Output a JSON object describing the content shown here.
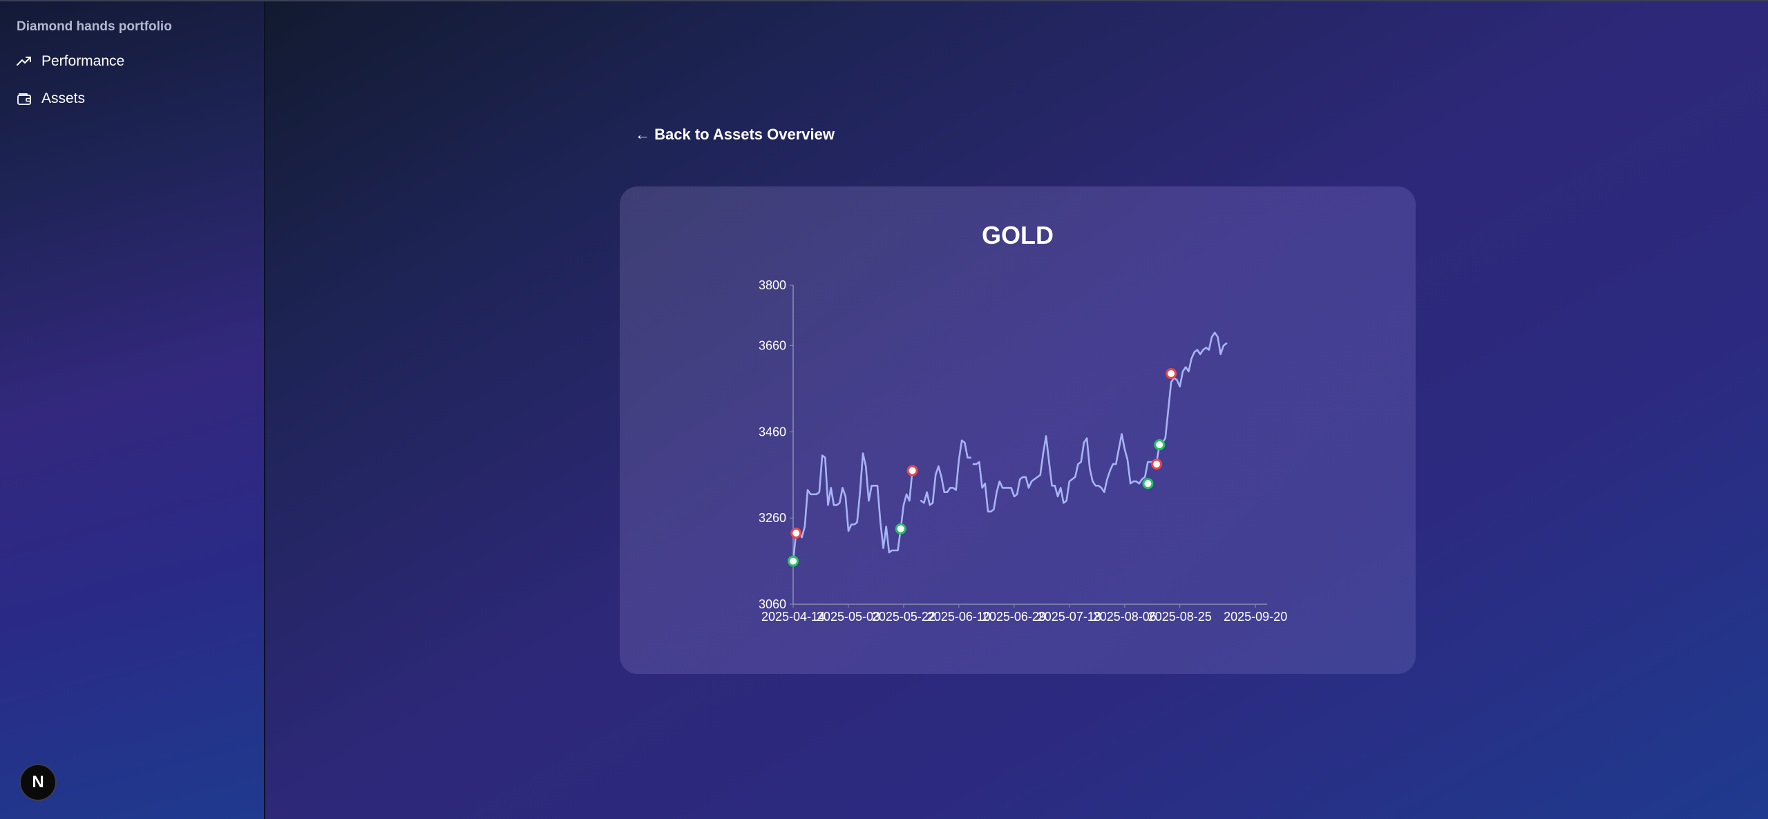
{
  "sidebar": {
    "brand": "Diamond hands portfolio",
    "items": [
      {
        "label": "Performance",
        "icon": "trending-up-icon"
      },
      {
        "label": "Assets",
        "icon": "wallet-icon"
      }
    ],
    "avatar": "N"
  },
  "main": {
    "back_link": "← Back to Assets Overview",
    "title": "GOLD"
  },
  "colors": {
    "line": "#a7b4f5",
    "buy_marker": "#22c55e",
    "sell_marker": "#ef4444",
    "axis": "#8a8fb0"
  },
  "chart_data": {
    "type": "line",
    "title": "GOLD",
    "xlabel": "",
    "ylabel": "",
    "x_range": [
      "2025-04-14",
      "2025-09-24"
    ],
    "ylim": [
      3060,
      3800
    ],
    "y_ticks": [
      3060,
      3260,
      3460,
      3660,
      3800
    ],
    "x_ticks": [
      "2025-04-14",
      "2025-05-03",
      "2025-05-22",
      "2025-06-10",
      "2025-06-29",
      "2025-07-18",
      "2025-08-06",
      "2025-08-25",
      "2025-09-20"
    ],
    "grid": false,
    "legend": "none",
    "series": [
      {
        "segments": [
          [
            [
              "2025-04-14",
              3160
            ],
            [
              "2025-04-15",
              3225
            ],
            [
              "2025-04-16",
              3230
            ],
            [
              "2025-04-17",
              3215
            ],
            [
              "2025-04-18",
              3240
            ],
            [
              "2025-04-19",
              3325
            ],
            [
              "2025-04-20",
              3315
            ],
            [
              "2025-04-21",
              3315
            ],
            [
              "2025-04-22",
              3315
            ],
            [
              "2025-04-23",
              3320
            ],
            [
              "2025-04-24",
              3405
            ],
            [
              "2025-04-25",
              3400
            ],
            [
              "2025-04-26",
              3290
            ],
            [
              "2025-04-27",
              3330
            ],
            [
              "2025-04-28",
              3290
            ],
            [
              "2025-04-29",
              3290
            ],
            [
              "2025-04-30",
              3295
            ],
            [
              "2025-05-01",
              3330
            ],
            [
              "2025-05-02",
              3310
            ],
            [
              "2025-05-03",
              3230
            ],
            [
              "2025-05-04",
              3245
            ],
            [
              "2025-05-05",
              3245
            ],
            [
              "2025-05-06",
              3250
            ],
            [
              "2025-05-07",
              3320
            ],
            [
              "2025-05-08",
              3410
            ],
            [
              "2025-05-09",
              3380
            ],
            [
              "2025-05-10",
              3300
            ],
            [
              "2025-05-11",
              3335
            ],
            [
              "2025-05-12",
              3335
            ],
            [
              "2025-05-13",
              3335
            ],
            [
              "2025-05-14",
              3250
            ],
            [
              "2025-05-15",
              3190
            ],
            [
              "2025-05-16",
              3240
            ],
            [
              "2025-05-17",
              3180
            ],
            [
              "2025-05-18",
              3185
            ],
            [
              "2025-05-19",
              3185
            ],
            [
              "2025-05-20",
              3185
            ],
            [
              "2025-05-21",
              3235
            ],
            [
              "2025-05-22",
              3290
            ],
            [
              "2025-05-23",
              3315
            ],
            [
              "2025-05-24",
              3300
            ],
            [
              "2025-05-25",
              3370
            ]
          ],
          [
            [
              "2025-05-28",
              3300
            ],
            [
              "2025-05-29",
              3295
            ],
            [
              "2025-05-30",
              3320
            ],
            [
              "2025-05-31",
              3290
            ],
            [
              "2025-06-01",
              3295
            ],
            [
              "2025-06-02",
              3360
            ],
            [
              "2025-06-03",
              3380
            ],
            [
              "2025-06-04",
              3355
            ],
            [
              "2025-06-05",
              3320
            ],
            [
              "2025-06-06",
              3320
            ],
            [
              "2025-06-07",
              3330
            ],
            [
              "2025-06-08",
              3330
            ],
            [
              "2025-06-09",
              3325
            ],
            [
              "2025-06-10",
              3395
            ],
            [
              "2025-06-11",
              3440
            ],
            [
              "2025-06-12",
              3435
            ],
            [
              "2025-06-13",
              3400
            ],
            [
              "2025-06-14",
              3400
            ]
          ],
          [
            [
              "2025-06-15",
              3385
            ],
            [
              "2025-06-16",
              3385
            ],
            [
              "2025-06-17",
              3390
            ],
            [
              "2025-06-18",
              3330
            ],
            [
              "2025-06-19",
              3340
            ],
            [
              "2025-06-20",
              3275
            ],
            [
              "2025-06-21",
              3275
            ],
            [
              "2025-06-22",
              3280
            ],
            [
              "2025-06-23",
              3320
            ],
            [
              "2025-06-24",
              3345
            ],
            [
              "2025-06-25",
              3330
            ],
            [
              "2025-06-26",
              3330
            ],
            [
              "2025-06-27",
              3330
            ],
            [
              "2025-06-28",
              3330
            ],
            [
              "2025-06-29",
              3310
            ],
            [
              "2025-06-30",
              3315
            ],
            [
              "2025-07-01",
              3350
            ],
            [
              "2025-07-02",
              3355
            ],
            [
              "2025-07-03",
              3355
            ],
            [
              "2025-07-04",
              3330
            ],
            [
              "2025-07-05",
              3345
            ],
            [
              "2025-07-06",
              3350
            ],
            [
              "2025-07-07",
              3355
            ],
            [
              "2025-07-08",
              3360
            ],
            [
              "2025-07-09",
              3410
            ],
            [
              "2025-07-10",
              3450
            ],
            [
              "2025-07-11",
              3390
            ],
            [
              "2025-07-12",
              3335
            ],
            [
              "2025-07-13",
              3335
            ],
            [
              "2025-07-14",
              3310
            ],
            [
              "2025-07-15",
              3330
            ],
            [
              "2025-07-16",
              3295
            ],
            [
              "2025-07-17",
              3300
            ],
            [
              "2025-07-18",
              3345
            ],
            [
              "2025-07-19",
              3350
            ],
            [
              "2025-07-20",
              3355
            ],
            [
              "2025-07-21",
              3385
            ],
            [
              "2025-07-22",
              3390
            ],
            [
              "2025-07-23",
              3435
            ],
            [
              "2025-07-24",
              3445
            ],
            [
              "2025-07-25",
              3375
            ],
            [
              "2025-07-26",
              3345
            ],
            [
              "2025-07-27",
              3335
            ],
            [
              "2025-07-28",
              3335
            ],
            [
              "2025-07-29",
              3330
            ],
            [
              "2025-07-30",
              3320
            ],
            [
              "2025-07-31",
              3350
            ],
            [
              "2025-08-01",
              3370
            ],
            [
              "2025-08-02",
              3385
            ],
            [
              "2025-08-03",
              3385
            ],
            [
              "2025-08-04",
              3420
            ],
            [
              "2025-08-05",
              3455
            ],
            [
              "2025-08-06",
              3420
            ],
            [
              "2025-08-07",
              3395
            ],
            [
              "2025-08-08",
              3340
            ],
            [
              "2025-08-09",
              3345
            ],
            [
              "2025-08-10",
              3345
            ],
            [
              "2025-08-11",
              3340
            ],
            [
              "2025-08-12",
              3350
            ],
            [
              "2025-08-13",
              3355
            ],
            [
              "2025-08-14",
              3390
            ],
            [
              "2025-08-15",
              3390
            ],
            [
              "2025-08-16",
              3390
            ],
            [
              "2025-08-17",
              3390
            ],
            [
              "2025-08-18",
              3430
            ],
            [
              "2025-08-19",
              3435
            ],
            [
              "2025-08-20",
              3445
            ],
            [
              "2025-08-21",
              3510
            ],
            [
              "2025-08-22",
              3575
            ],
            [
              "2025-08-23",
              3585
            ],
            [
              "2025-08-24",
              3580
            ],
            [
              "2025-08-25",
              3565
            ],
            [
              "2025-08-26",
              3600
            ],
            [
              "2025-08-27",
              3610
            ],
            [
              "2025-08-28",
              3600
            ],
            [
              "2025-08-29",
              3630
            ],
            [
              "2025-08-30",
              3645
            ],
            [
              "2025-08-31",
              3650
            ],
            [
              "2025-09-01",
              3640
            ],
            [
              "2025-09-02",
              3650
            ],
            [
              "2025-09-03",
              3655
            ],
            [
              "2025-09-04",
              3650
            ],
            [
              "2025-09-05",
              3680
            ],
            [
              "2025-09-06",
              3690
            ],
            [
              "2025-09-07",
              3680
            ],
            [
              "2025-09-08",
              3640
            ],
            [
              "2025-09-09",
              3660
            ],
            [
              "2025-09-10",
              3665
            ]
          ]
        ]
      }
    ],
    "markers": [
      {
        "x": "2025-04-14",
        "y": 3160,
        "type": "buy"
      },
      {
        "x": "2025-04-15",
        "y": 3225,
        "type": "sell"
      },
      {
        "x": "2025-05-21",
        "y": 3235,
        "type": "buy"
      },
      {
        "x": "2025-05-25",
        "y": 3370,
        "type": "sell"
      },
      {
        "x": "2025-08-14",
        "y": 3340,
        "type": "buy"
      },
      {
        "x": "2025-08-17",
        "y": 3385,
        "type": "sell"
      },
      {
        "x": "2025-08-18",
        "y": 3430,
        "type": "buy"
      },
      {
        "x": "2025-08-22",
        "y": 3595,
        "type": "sell"
      }
    ]
  }
}
